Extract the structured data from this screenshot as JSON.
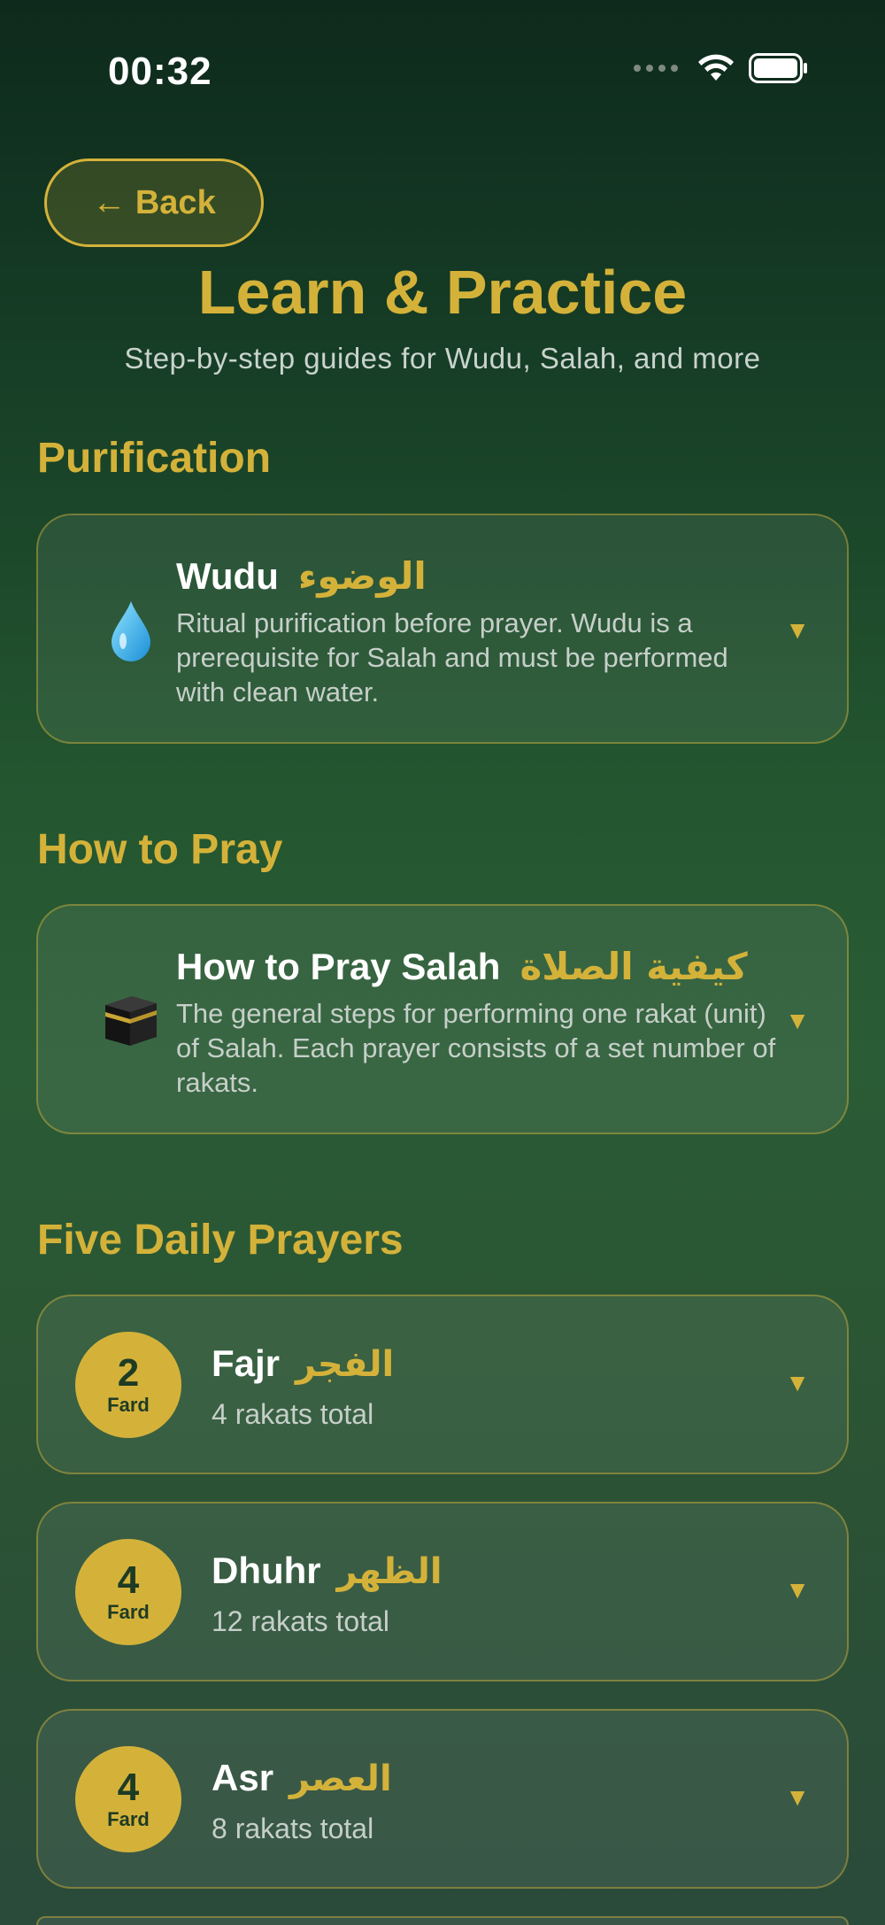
{
  "status_bar": {
    "time": "00:32"
  },
  "header": {
    "back_label": "← Back",
    "title": "Learn & Practice",
    "subtitle": "Step-by-step guides for Wudu, Salah, and more"
  },
  "sections": {
    "purification": {
      "title": "Purification",
      "card": {
        "name": "Wudu",
        "arabic": "الوضوء",
        "description": "Ritual purification before prayer. Wudu is a prerequisite for Salah and must be performed with clean water.",
        "icon": "water-drop-icon"
      }
    },
    "how_to_pray": {
      "title": "How to Pray",
      "card": {
        "name": "How to Pray Salah",
        "arabic": "كيفية الصلاة",
        "description": "The general steps for performing one rakat (unit) of Salah. Each prayer consists of a set number of rakats.",
        "icon": "kaaba-icon"
      }
    },
    "daily_prayers": {
      "title": "Five Daily Prayers",
      "prayers": [
        {
          "fard": "2",
          "fard_label": "Fard",
          "name": "Fajr",
          "arabic": "الفجر",
          "total": "4 rakats total"
        },
        {
          "fard": "4",
          "fard_label": "Fard",
          "name": "Dhuhr",
          "arabic": "الظهر",
          "total": "12 rakats total"
        },
        {
          "fard": "4",
          "fard_label": "Fard",
          "name": "Asr",
          "arabic": "العصر",
          "total": "8 rakats total"
        }
      ]
    }
  },
  "chevron_glyph": "▼",
  "colors": {
    "accent_gold": "#d4b23a",
    "text_white": "#ffffff",
    "text_muted": "#c6cfc9",
    "background_top": "#0e2a1c",
    "background_mid": "#2a5c35"
  }
}
